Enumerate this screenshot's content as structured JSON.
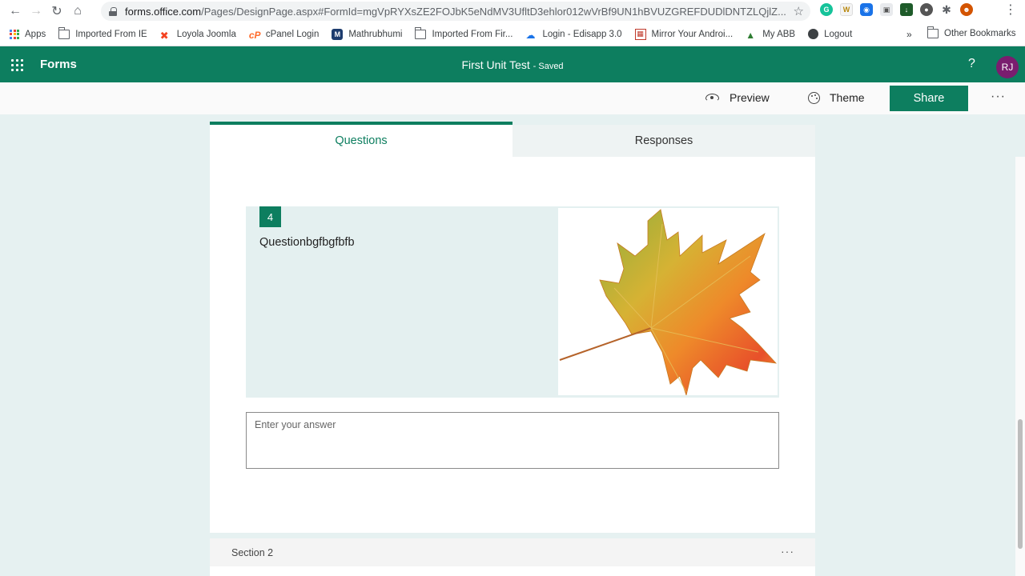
{
  "browser": {
    "url_host": "forms.office.com",
    "url_path": "/Pages/DesignPage.aspx#FormId=mgVpRYXsZE2FOJbK5eNdMV3UfltD3ehlor012wVrBf9UN1hBVUZGREFDUDlDNTZLQjlZ...",
    "bookmarks": [
      {
        "label": "Apps",
        "icon": "apps-icon"
      },
      {
        "label": "Imported From IE",
        "icon": "folder-icon"
      },
      {
        "label": "Loyola Joomla",
        "icon": "joomla-icon"
      },
      {
        "label": "cPanel Login",
        "icon": "cpanel-icon"
      },
      {
        "label": "Mathrubhumi",
        "icon": "mathrubhumi-icon"
      },
      {
        "label": "Imported From Fir...",
        "icon": "folder-icon"
      },
      {
        "label": "Login - Edisapp 3.0",
        "icon": "cloud-icon"
      },
      {
        "label": "Mirror Your Androi...",
        "icon": "mirror-icon"
      },
      {
        "label": "My ABB",
        "icon": "abb-icon"
      },
      {
        "label": "Logout",
        "icon": "globe-icon"
      }
    ],
    "more_bookmarks": "»",
    "other_bookmarks": "Other Bookmarks",
    "avatar_initials_ext": ""
  },
  "header": {
    "app_name": "Forms",
    "form_title": "First Unit Test",
    "save_status": "- Saved",
    "help": "?",
    "user_initials": "RJ"
  },
  "commands": {
    "preview": "Preview",
    "theme": "Theme",
    "share": "Share",
    "more": "···"
  },
  "tabs": {
    "questions": "Questions",
    "responses": "Responses"
  },
  "question": {
    "number": "4",
    "text": "Questionbgfbgfbfb",
    "answer_placeholder": "Enter your answer"
  },
  "section": {
    "label": "Section 2",
    "more": "···"
  },
  "colors": {
    "brand": "#0d7e5f",
    "page_bg": "#e6f1f1",
    "question_bg": "#e4f0f0",
    "avatar": "#7a1d6f"
  }
}
